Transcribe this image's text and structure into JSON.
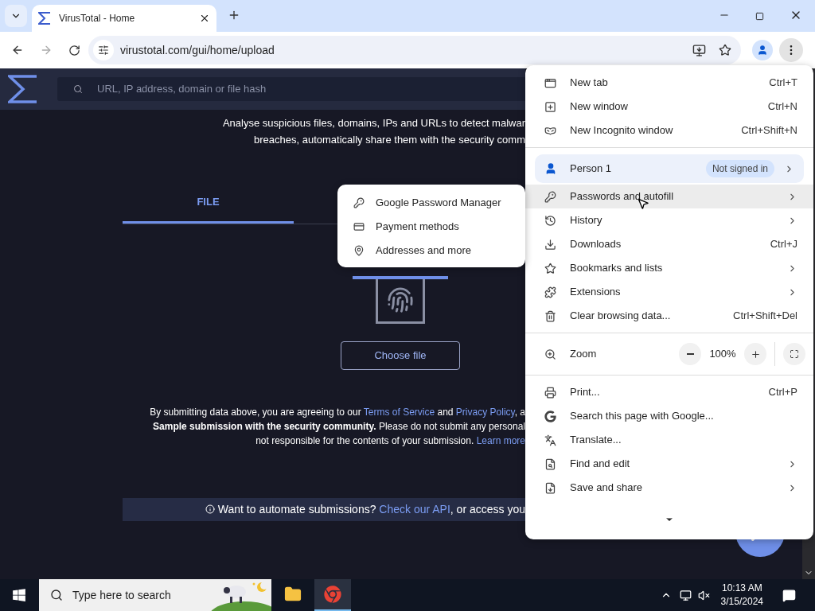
{
  "browser": {
    "tab": {
      "title": "VirusTotal - Home"
    },
    "url": "virustotal.com/gui/home/upload"
  },
  "page": {
    "search": {
      "placeholder": "URL, IP address, domain or file hash"
    },
    "tagline": [
      "Analyse suspicious files, domains, IPs and URLs to detect malwar",
      "breaches, automatically share them with the security comm"
    ],
    "tabs": [
      {
        "label": "FILE",
        "selected": true
      }
    ],
    "choose_button": "Choose file",
    "terms": [
      [
        {
          "kind": "plain",
          "text": "By submitting data above, you are agreeing to our "
        },
        {
          "kind": "link",
          "text": "Terms of Service"
        },
        {
          "kind": "plain",
          "text": " and "
        },
        {
          "kind": "link",
          "text": "Privacy Policy"
        },
        {
          "kind": "plain",
          "text": ", a"
        }
      ],
      [
        {
          "kind": "bold",
          "text": "Sample submission with the security community."
        },
        {
          "kind": "plain",
          "text": " Please do not submit any personal"
        }
      ],
      [
        {
          "kind": "plain",
          "text": "not responsible for the contents of your submission. "
        },
        {
          "kind": "link",
          "text": "Learn more"
        }
      ]
    ],
    "banner": [
      {
        "kind": "plain",
        "text": "Want to automate submissions? "
      },
      {
        "kind": "link",
        "text": "Check our API"
      },
      {
        "kind": "plain",
        "text": ", or access you"
      }
    ]
  },
  "submenu": [
    {
      "label": "Google Password Manager"
    },
    {
      "label": "Payment methods"
    },
    {
      "label": "Addresses and more"
    }
  ],
  "menu": [
    {
      "kind": "item",
      "label": "New tab",
      "shortcut": "Ctrl+T",
      "submenu": false,
      "selected": false
    },
    {
      "kind": "item",
      "label": "New window",
      "shortcut": "Ctrl+N",
      "submenu": false,
      "selected": false
    },
    {
      "kind": "item",
      "label": "New Incognito window",
      "shortcut": "Ctrl+Shift+N",
      "submenu": false,
      "selected": false
    },
    {
      "kind": "separator"
    },
    {
      "kind": "profile",
      "label": "Person 1",
      "status": "Not signed in",
      "submenu": true,
      "selected": false
    },
    {
      "kind": "item",
      "label": "Passwords and autofill",
      "submenu": true,
      "selected": true
    },
    {
      "kind": "item",
      "label": "History",
      "submenu": true,
      "selected": false
    },
    {
      "kind": "item",
      "label": "Downloads",
      "shortcut": "Ctrl+J",
      "submenu": false,
      "selected": false
    },
    {
      "kind": "item",
      "label": "Bookmarks and lists",
      "submenu": true,
      "selected": false
    },
    {
      "kind": "item",
      "label": "Extensions",
      "submenu": true,
      "selected": false
    },
    {
      "kind": "item",
      "label": "Clear browsing data...",
      "shortcut": "Ctrl+Shift+Del",
      "submenu": false,
      "selected": false
    },
    {
      "kind": "separator"
    },
    {
      "kind": "zoom",
      "label": "Zoom",
      "value": "100%"
    },
    {
      "kind": "separator"
    },
    {
      "kind": "item",
      "label": "Print...",
      "shortcut": "Ctrl+P",
      "submenu": false,
      "selected": false
    },
    {
      "kind": "item",
      "label": "Search this page with Google...",
      "submenu": false,
      "selected": false
    },
    {
      "kind": "item",
      "label": "Translate...",
      "submenu": false,
      "selected": false
    },
    {
      "kind": "item",
      "label": "Find and edit",
      "submenu": true,
      "selected": false
    },
    {
      "kind": "item",
      "label": "Save and share",
      "submenu": true,
      "selected": false
    }
  ],
  "taskbar": {
    "search": {
      "placeholder": "Type here to search"
    },
    "apps": [
      {
        "selected": false
      },
      {
        "selected": true
      }
    ],
    "time": "10:13 AM",
    "date": "3/15/2024"
  }
}
